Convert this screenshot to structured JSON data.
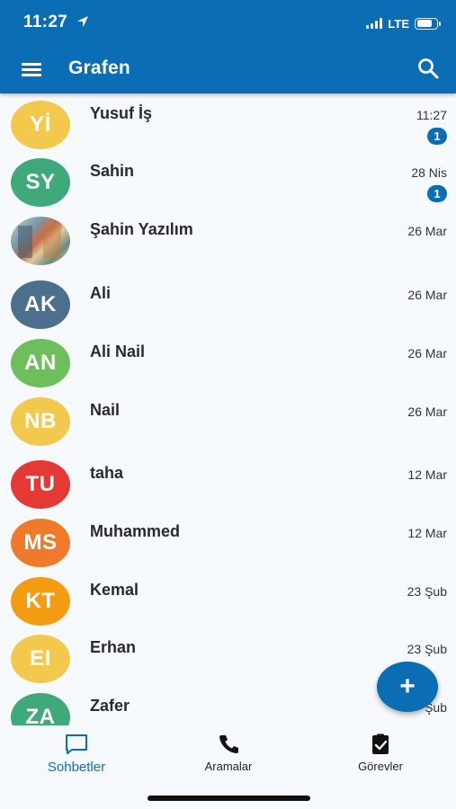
{
  "status_bar": {
    "time": "11:27",
    "network": "LTE"
  },
  "header": {
    "title": "Grafen"
  },
  "colors": {
    "primary": "#0b6db3",
    "background": "#f7fafd"
  },
  "chats": [
    {
      "initials": "Yİ",
      "name": "Yusuf İş",
      "time": "11:27",
      "unread": "1",
      "color": "#f2c94c"
    },
    {
      "initials": "SY",
      "name": "Sahin",
      "time": "28 Nis",
      "unread": "1",
      "color": "#3fa97a"
    },
    {
      "initials": "",
      "name": "Şahin Yazılım",
      "time": "26 Mar",
      "unread": "",
      "color": "",
      "photo": true
    },
    {
      "initials": "AK",
      "name": "Ali",
      "time": "26 Mar",
      "unread": "",
      "color": "#4d6f8e"
    },
    {
      "initials": "AN",
      "name": "Ali Nail",
      "time": "26 Mar",
      "unread": "",
      "color": "#6cbf5b"
    },
    {
      "initials": "NB",
      "name": "Nail",
      "time": "26 Mar",
      "unread": "",
      "color": "#f2c94c"
    },
    {
      "initials": "TU",
      "name": "taha",
      "time": "12 Mar",
      "unread": "",
      "color": "#e53935"
    },
    {
      "initials": "MS",
      "name": "Muhammed",
      "time": "12 Mar",
      "unread": "",
      "color": "#ef7b2a"
    },
    {
      "initials": "KT",
      "name": "Kemal",
      "time": "23 Şub",
      "unread": "",
      "color": "#f39c12"
    },
    {
      "initials": "EI",
      "name": "Erhan",
      "time": "23 Şub",
      "unread": "",
      "color": "#f2c94c"
    },
    {
      "initials": "ZA",
      "name": "Zafer",
      "time": "Şub",
      "unread": "",
      "color": "#3fa97a"
    }
  ],
  "fab": {
    "icon": "plus-icon",
    "label": "+"
  },
  "bottom_nav": [
    {
      "label": "Sohbetler",
      "icon": "chat-bubble-icon",
      "active": true
    },
    {
      "label": "Aramalar",
      "icon": "phone-icon",
      "active": false
    },
    {
      "label": "Görevler",
      "icon": "task-check-icon",
      "active": false
    }
  ]
}
